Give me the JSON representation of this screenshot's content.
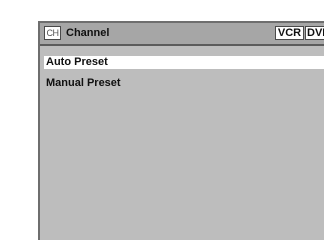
{
  "header": {
    "icon_label": "CH",
    "title": "Channel",
    "modes": [
      "VCR",
      "DVD"
    ]
  },
  "menu": {
    "items": [
      {
        "label": "Auto Preset",
        "selected": true
      },
      {
        "label": "Manual Preset",
        "selected": false
      }
    ]
  },
  "colors": {
    "panel": "#bdbdbd",
    "header": "#a6a6a6",
    "highlight": "#ffffff",
    "text": "#111111"
  }
}
